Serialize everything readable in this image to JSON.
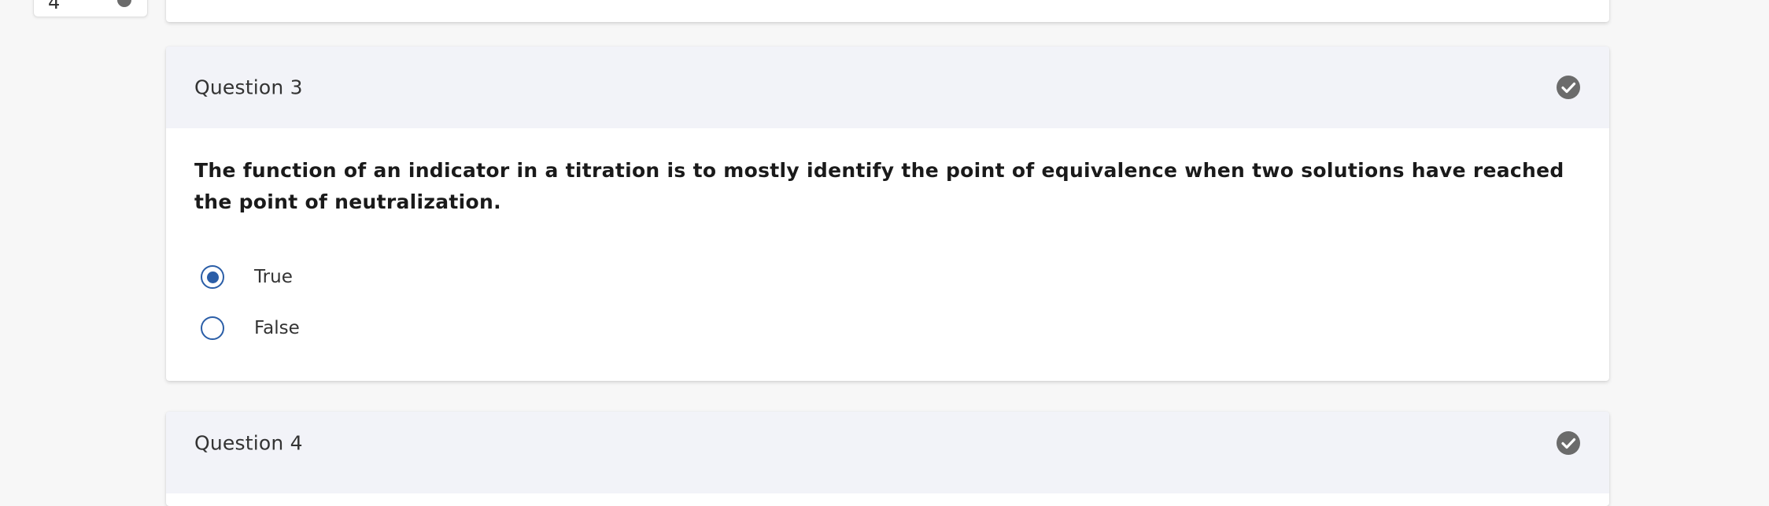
{
  "navigator": {
    "number": "4"
  },
  "questions": [
    {
      "title": "Question 3",
      "status_icon": "check-circle-icon",
      "prompt": "The function of an indicator in a titration is to mostly identify the point of equivalence when two solutions have reached the point of neutralization.",
      "choices": [
        {
          "label": "True",
          "selected": true
        },
        {
          "label": "False",
          "selected": false
        }
      ]
    },
    {
      "title": "Question 4",
      "status_icon": "check-circle-icon"
    }
  ],
  "colors": {
    "page_background": "#f7f7f7",
    "header_background": "#f2f3f8",
    "radio_accent": "#2b5ea7",
    "check_icon": "#6b6b6b"
  }
}
